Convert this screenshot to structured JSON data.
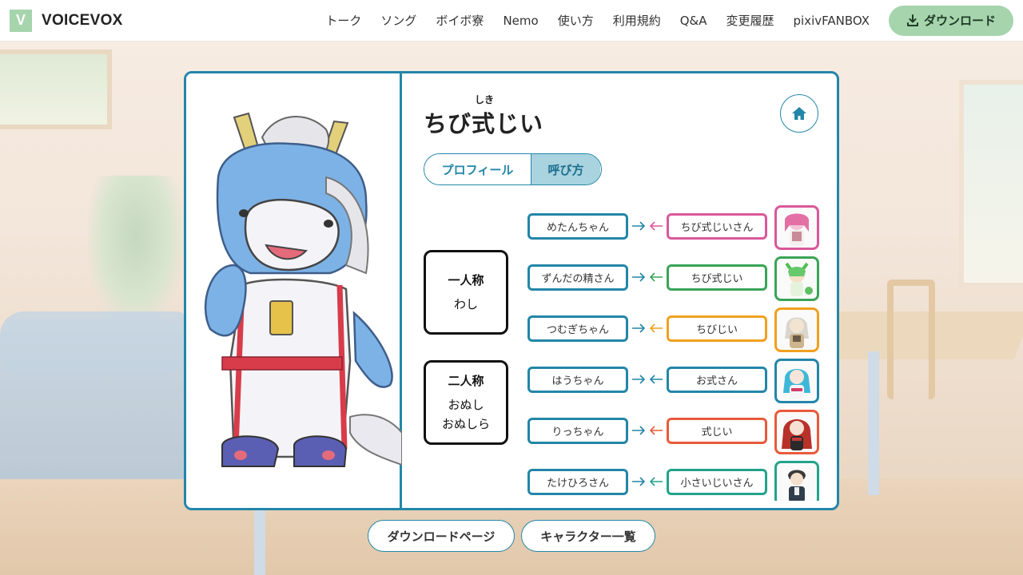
{
  "header": {
    "logo_letter": "V",
    "logo_text": "VOICEVOX",
    "nav": [
      "トーク",
      "ソング",
      "ボイボ寮",
      "Nemo",
      "使い方",
      "利用規約",
      "Q&A",
      "変更履歴",
      "pixivFANBOX"
    ],
    "download_label": "ダウンロード"
  },
  "character": {
    "name": "ちび式じい",
    "ruby": "しき"
  },
  "tabs": {
    "profile": "プロフィール",
    "call": "呼び方",
    "active": "call"
  },
  "pronouns": {
    "first_person_title": "一人称",
    "first_person_value": "わし",
    "second_person_title": "二人称",
    "second_person_value_1": "おぬし",
    "second_person_value_2": "おぬしら"
  },
  "call_rows": [
    {
      "outgoing": "めたんちゃん",
      "incoming": "ちび式じいさん",
      "color": "#d9589a"
    },
    {
      "outgoing": "ずんだの精さん",
      "incoming": "ちび式じい",
      "color": "#3aa457"
    },
    {
      "outgoing": "つむぎちゃん",
      "incoming": "ちびじい",
      "color": "#f0a020"
    },
    {
      "outgoing": "はうちゃん",
      "incoming": "お式さん",
      "color": "#2386a8"
    },
    {
      "outgoing": "りっちゃん",
      "incoming": "式じい",
      "color": "#e85a3c"
    },
    {
      "outgoing": "たけひろさん",
      "incoming": "小さいじいさん",
      "color": "#22a38a"
    }
  ],
  "colors": {
    "accent": "#2386a8",
    "download_button": "#a5d4ad",
    "active_tab": "#a9d3df"
  },
  "bottom_buttons": {
    "download_page": "ダウンロードページ",
    "character_list": "キャラクター一覧"
  }
}
